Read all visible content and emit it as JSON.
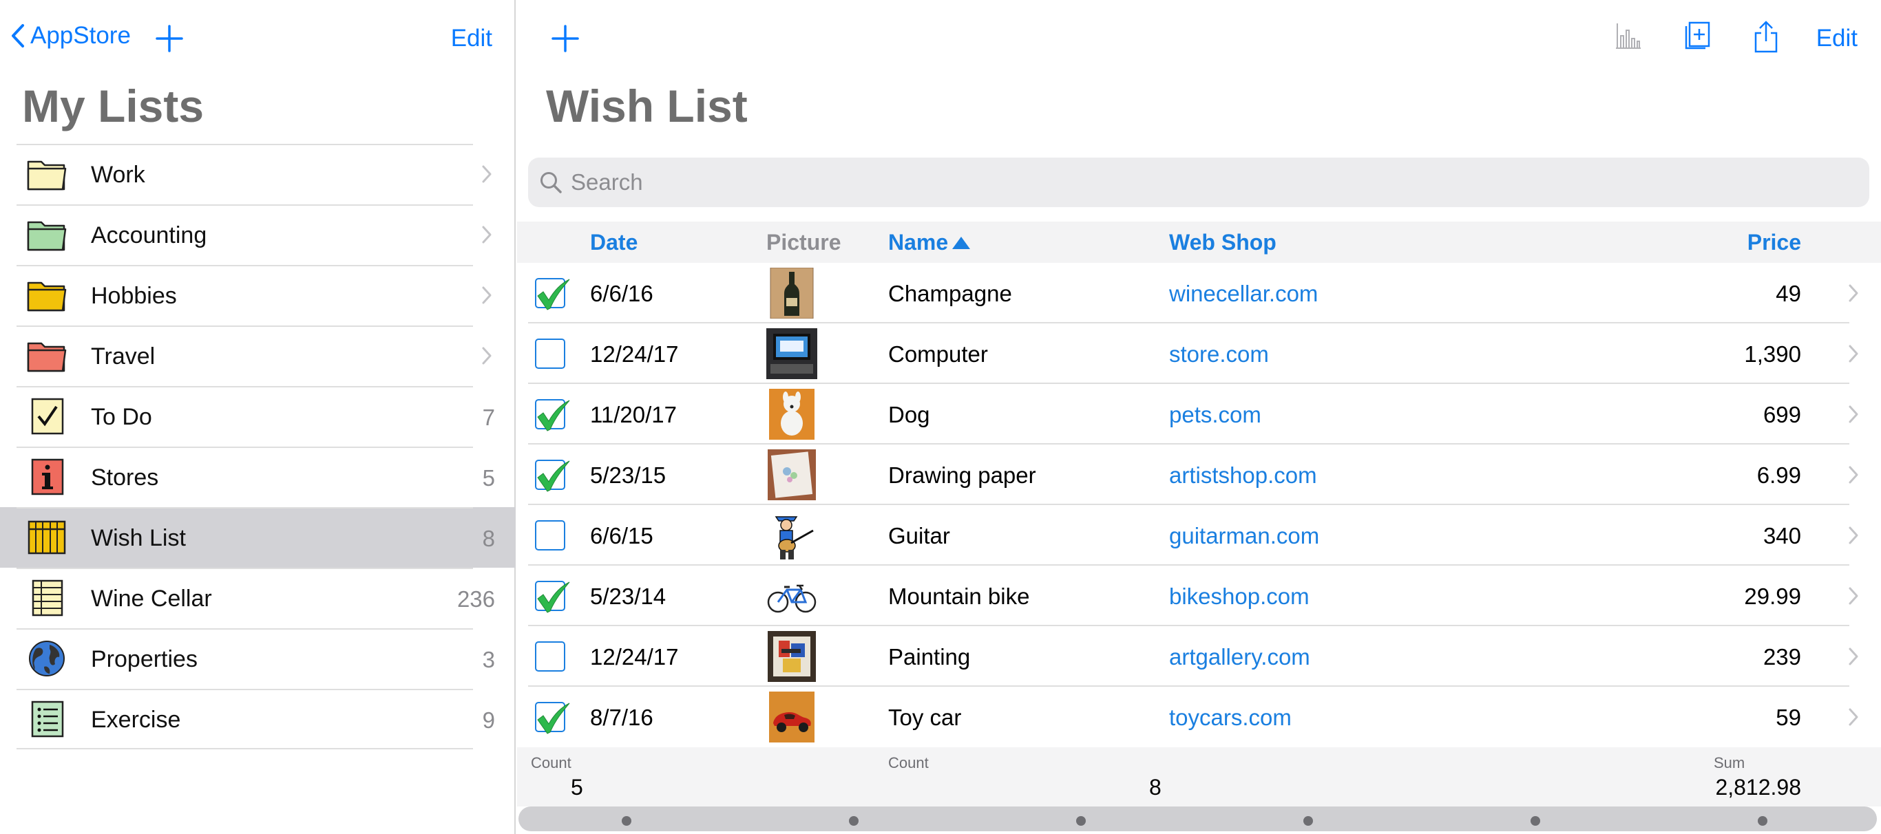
{
  "left": {
    "back_label": "AppStore",
    "edit_label": "Edit",
    "title": "My Lists",
    "items": [
      {
        "label": "Work",
        "count": "",
        "icon": "folder-icon",
        "color": "#fbf4be"
      },
      {
        "label": "Accounting",
        "count": "",
        "icon": "folder-icon",
        "color": "#a8dca8"
      },
      {
        "label": "Hobbies",
        "count": "",
        "icon": "folder-icon",
        "color": "#f2c20a"
      },
      {
        "label": "Travel",
        "count": "",
        "icon": "folder-icon",
        "color": "#f07868"
      },
      {
        "label": "To Do",
        "count": "7",
        "icon": "checkbox-note-icon",
        "color": "#fbf4be"
      },
      {
        "label": "Stores",
        "count": "5",
        "icon": "info-icon",
        "color": "#ef6b5e"
      },
      {
        "label": "Wish List",
        "count": "8",
        "icon": "table-grid-icon",
        "color": "#f2c20a"
      },
      {
        "label": "Wine Cellar",
        "count": "236",
        "icon": "table-lines-icon",
        "color": "#fbf4be"
      },
      {
        "label": "Properties",
        "count": "3",
        "icon": "globe-icon",
        "color": "#3a7bd5"
      },
      {
        "label": "Exercise",
        "count": "9",
        "icon": "bullet-list-icon",
        "color": "#bfe6c3"
      }
    ],
    "selected_index": 6
  },
  "right": {
    "title": "Wish List",
    "edit_label": "Edit",
    "search_placeholder": "Search",
    "columns": {
      "date": "Date",
      "picture": "Picture",
      "name": "Name",
      "shop": "Web Shop",
      "price": "Price"
    },
    "sort_column": "Name",
    "sort_direction": "ascending",
    "rows": [
      {
        "checked": true,
        "date": "6/6/16",
        "picture": "champagne-bottle-photo",
        "name": "Champagne",
        "shop": "winecellar.com",
        "price": "49"
      },
      {
        "checked": false,
        "date": "12/24/17",
        "picture": "computer-photo",
        "name": "Computer",
        "shop": "store.com",
        "price": "1,390"
      },
      {
        "checked": true,
        "date": "11/20/17",
        "picture": "dog-figurine-photo",
        "name": "Dog",
        "shop": "pets.com",
        "price": "699"
      },
      {
        "checked": true,
        "date": "5/23/15",
        "picture": "drawing-paper-photo",
        "name": "Drawing paper",
        "shop": "artistshop.com",
        "price": "6.99"
      },
      {
        "checked": false,
        "date": "6/6/15",
        "picture": "guitarist-cartoon",
        "name": "Guitar",
        "shop": "guitarman.com",
        "price": "340"
      },
      {
        "checked": true,
        "date": "5/23/14",
        "picture": "bicycle-drawing",
        "name": "Mountain bike",
        "shop": "bikeshop.com",
        "price": "29.99"
      },
      {
        "checked": false,
        "date": "12/24/17",
        "picture": "painting-photo",
        "name": "Painting",
        "shop": "artgallery.com",
        "price": "239"
      },
      {
        "checked": true,
        "date": "8/7/16",
        "picture": "red-toy-car-photo",
        "name": "Toy car",
        "shop": "toycars.com",
        "price": "59"
      }
    ],
    "summary": {
      "date_label": "Count",
      "date_value": "5",
      "name_label": "Count",
      "name_value": "8",
      "price_label": "Sum",
      "price_value": "2,812.98"
    },
    "scroll_dots": 6
  },
  "colors": {
    "accent": "#0a7aff",
    "link": "#1a7fe0",
    "check_green": "#2db84c",
    "selected_row": "#d2d2d6"
  }
}
